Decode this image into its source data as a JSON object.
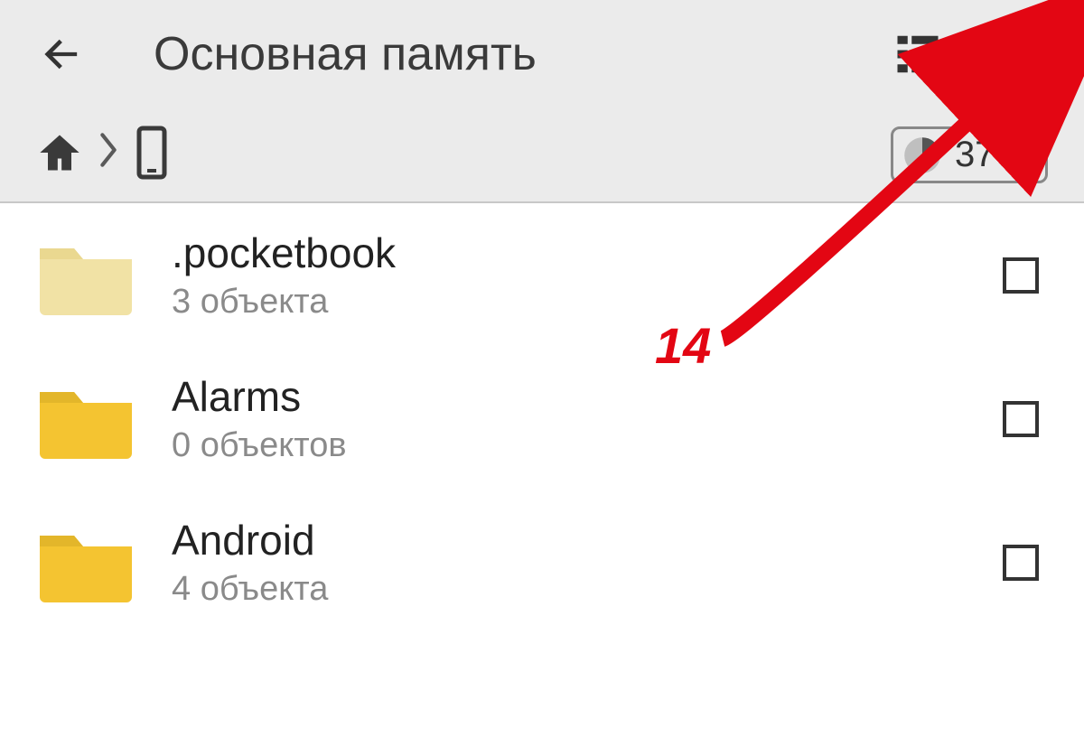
{
  "header": {
    "title": "Основная память"
  },
  "storage": {
    "percent_label": "37%"
  },
  "files": [
    {
      "name": ".pocketbook",
      "subtitle": "3 объекта",
      "faded": true
    },
    {
      "name": "Alarms",
      "subtitle": "0 объектов",
      "faded": false
    },
    {
      "name": "Android",
      "subtitle": "4 объекта",
      "faded": false
    }
  ],
  "annotation": {
    "label": "14"
  }
}
